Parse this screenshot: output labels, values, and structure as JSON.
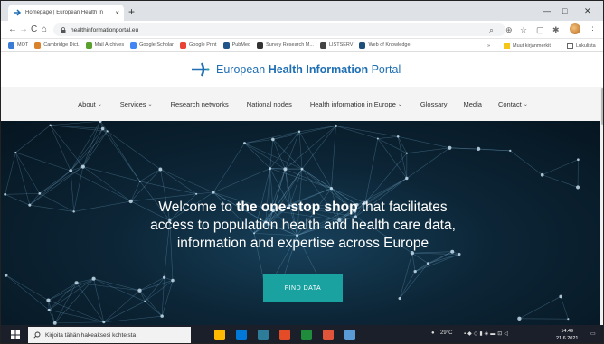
{
  "browser": {
    "tab_title": "Homepage | European Health In",
    "tab_close": "×",
    "new_tab": "+",
    "url": "healthinformationportal.eu",
    "window_min": "—",
    "window_max": "□",
    "window_close": "✕",
    "nav_back": "←",
    "nav_forward": "→",
    "nav_reload": "C",
    "nav_home": "⌂"
  },
  "bookmarks": [
    {
      "label": "MOT",
      "color": "#3a7bd5"
    },
    {
      "label": "Cambridge Dict.",
      "color": "#d9822b"
    },
    {
      "label": "Mail Archives",
      "color": "#5aa02c"
    },
    {
      "label": "Google Scholar",
      "color": "#4285f4"
    },
    {
      "label": "Google Print",
      "color": "#ea4335"
    },
    {
      "label": "PubMed",
      "color": "#20558a"
    },
    {
      "label": "Survey Research M...",
      "color": "#333333"
    },
    {
      "label": "LISTSERV",
      "color": "#444444"
    },
    {
      "label": "Web of Knowledge",
      "color": "#1d4f7a"
    }
  ],
  "bookmarks_right": {
    "more": "»",
    "other": "Muut kirjanmerkit",
    "reading": "Lukulista"
  },
  "site": {
    "logo_prefix": "European ",
    "logo_bold": "Health Information",
    "logo_suffix": " Portal",
    "nav": [
      {
        "label": "About",
        "dropdown": true
      },
      {
        "label": "Services",
        "dropdown": true
      },
      {
        "label": "Research networks",
        "dropdown": false
      },
      {
        "label": "National nodes",
        "dropdown": false
      },
      {
        "label": "Health information in Europe",
        "dropdown": true
      },
      {
        "label": "Glossary",
        "dropdown": false
      },
      {
        "label": "Media",
        "dropdown": false
      },
      {
        "label": "Contact",
        "dropdown": true
      }
    ],
    "caret": "⌄",
    "hero": {
      "line1_pre": "Welcome to ",
      "line1_bold": "the one-stop shop",
      "line1_post": " that facilitates",
      "line2": "access to population health and health care data,",
      "line3": "information and expertise across Europe",
      "button": "FIND DATA"
    }
  },
  "taskbar": {
    "search_placeholder": "Kirjoita tähän hakeaksesi kohteista",
    "weather": "29°C",
    "time": "14.49",
    "date": "21.6.2021",
    "app_colors": [
      "#ffb900",
      "#0078d7",
      "#2d7d9a",
      "#e34c26",
      "#1e8c3a",
      "#e0543a",
      "#5b9bd5"
    ]
  }
}
